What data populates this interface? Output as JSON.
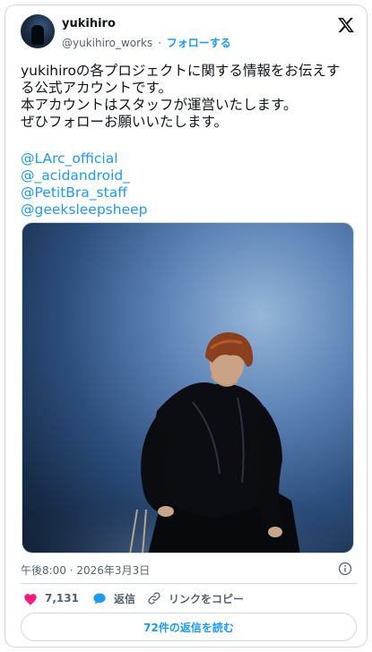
{
  "author": {
    "name": "yukihiro",
    "handle": "@yukihiro_works",
    "separator": "·",
    "follow_label": "フォローする"
  },
  "tweet": {
    "lines": [
      "yukihiroの各プロジェクトに関する情報をお伝えす",
      "る公式アカウントです。",
      "本アカウントはスタッフが運営いたします。",
      "ぜひフォローお願いいたします。"
    ],
    "mentions": [
      "@LArc_official",
      "@_acidandroid_",
      "@PetitBra_staff",
      "@geeksleepsheep"
    ],
    "timestamp": "午後8:00 · 2026年3月3日"
  },
  "actions": {
    "like_count": "7,131",
    "reply_label": "返信",
    "copy_link_label": "リンクをコピー"
  },
  "read_replies_label": "72件の返信を読む",
  "colors": {
    "accent": "#1d9bf0",
    "like": "#f91880",
    "text": "#0f1419",
    "muted": "#536471",
    "border": "#cfd9de"
  },
  "icons": [
    "x-logo-icon",
    "info-icon",
    "heart-icon",
    "reply-bubble-icon",
    "link-icon"
  ]
}
